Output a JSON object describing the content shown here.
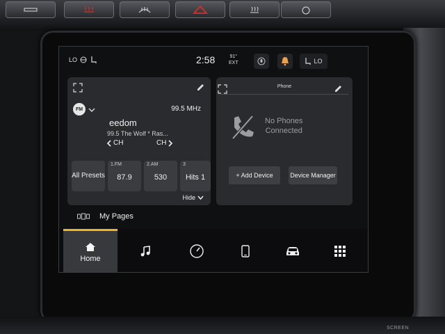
{
  "status_bar": {
    "left_label": "LO",
    "time": "2:58",
    "temp_value": "91°",
    "temp_label": "EXT",
    "right_label": "LO"
  },
  "radio": {
    "band_badge": "FM",
    "frequency": "99.5 MHz",
    "station_name": "eedom",
    "station_subtitle": "99.5 The Wolf * Ras...",
    "ch_prev": "CH",
    "ch_next": "CH",
    "all_presets": "All Presets",
    "presets": [
      {
        "label": "1.FM",
        "value": "87.9"
      },
      {
        "label": "2.AM",
        "value": "530"
      },
      {
        "label": "3",
        "value": "Hits 1"
      }
    ],
    "hide_label": "Hide"
  },
  "phone": {
    "title": "Phone",
    "status_line1": "No Phones",
    "status_line2": "Connected",
    "add_device": "+ Add Device",
    "device_manager": "Device Manager"
  },
  "my_pages_label": "My Pages",
  "nav": {
    "home_label": "Home",
    "items": [
      "home-icon",
      "music-note-icon",
      "gauge-icon",
      "smartphone-icon",
      "car-icon",
      "apps-grid-icon"
    ],
    "accent": "#f0b42a"
  },
  "hardware": {
    "screen_label": "SCREEN",
    "hazard_color": "#d0312d"
  }
}
